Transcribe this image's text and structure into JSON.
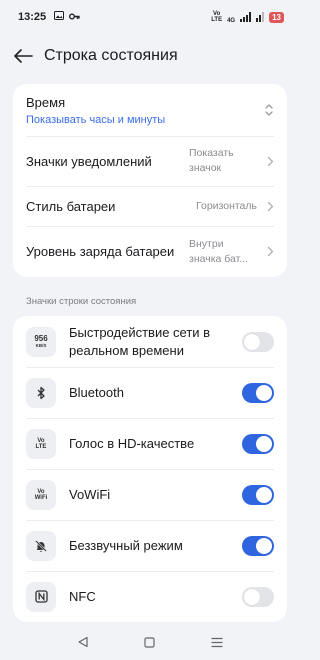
{
  "status_bar": {
    "time": "13:25",
    "volte": "Vo\nLTE",
    "network": "4G",
    "battery": "13"
  },
  "header": {
    "title": "Строка состояния"
  },
  "settings": {
    "time": {
      "label": "Время",
      "value": "Показывать часы и минуты"
    },
    "notif_icons": {
      "label": "Значки уведомлений",
      "value": "Показать значок"
    },
    "battery_style": {
      "label": "Стиль батареи",
      "value": "Горизонталь"
    },
    "battery_level": {
      "label": "Уровень заряда батареи",
      "value": "Внутри значка бат..."
    }
  },
  "section_title": "Значки строки состояния",
  "toggles": [
    {
      "label": "Быстродействие сети в реальном времени",
      "on": false,
      "icon": "network-speed-icon",
      "icon_text": "956",
      "icon_unit": "KB/S"
    },
    {
      "label": "Bluetooth",
      "on": true,
      "icon": "bluetooth-icon"
    },
    {
      "label": "Голос в HD-качестве",
      "on": true,
      "icon": "volte-icon",
      "icon_text": "Vo\nLTE"
    },
    {
      "label": "VoWiFi",
      "on": true,
      "icon": "vowifi-icon",
      "icon_text": "Vo\nWiFi"
    },
    {
      "label": "Беззвучный режим",
      "on": true,
      "icon": "silent-mode-icon"
    },
    {
      "label": "NFC",
      "on": false,
      "icon": "nfc-icon"
    }
  ],
  "colors": {
    "accent": "#2f66e0",
    "link": "#3a6ee8",
    "background": "#f1f3f7"
  }
}
